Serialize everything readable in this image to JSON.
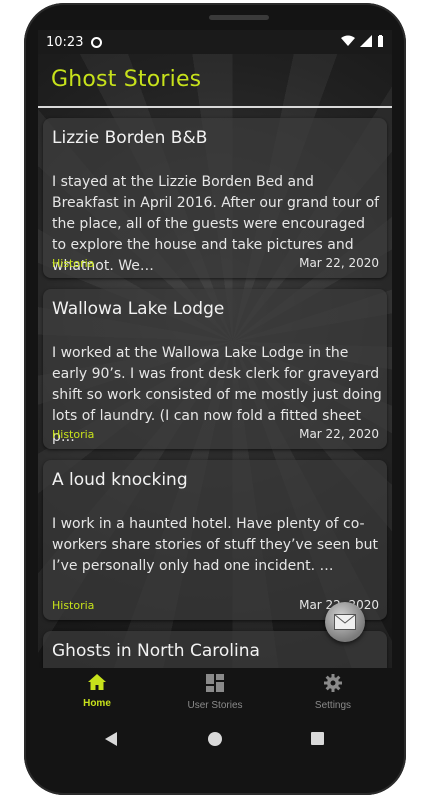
{
  "status": {
    "time": "10:23"
  },
  "app": {
    "title": "Ghost Stories"
  },
  "stories": [
    {
      "title": "Lizzie Borden B&B",
      "body": "I stayed at the Lizzie Borden Bed and Breakfast in April 2016. After our grand tour of the place, all of the guests were encouraged to explore the house and take pictures and whatnot. We…",
      "tag": "Historia",
      "date": "Mar 22, 2020"
    },
    {
      "title": "Wallowa Lake Lodge",
      "body": "I worked at the Wallowa Lake Lodge in the early 90’s. I was front desk clerk for graveyard shift so work consisted of me mostly just doing lots of laundry. (I can now fold a fitted sheet p…",
      "tag": "Historia",
      "date": "Mar 22, 2020"
    },
    {
      "title": "A loud knocking",
      "body": "I work in a haunted hotel. Have plenty of co-workers share stories of stuff they’ve seen but I’ve personally only had one incident. …",
      "tag": "Historia",
      "date": "Mar 22, 2020"
    },
    {
      "title": "Ghosts in North Carolina",
      "body": "",
      "tag": "",
      "date": ""
    }
  ],
  "nav": {
    "home": "Home",
    "user_stories": "User Stories",
    "settings": "Settings"
  },
  "colors": {
    "accent": "#c7e21b",
    "inactive": "#8a8a8a"
  },
  "icons": [
    "home-icon",
    "user-stories-icon",
    "settings-icon",
    "mail-icon",
    "back-icon",
    "home-circle-icon",
    "recents-icon"
  ]
}
